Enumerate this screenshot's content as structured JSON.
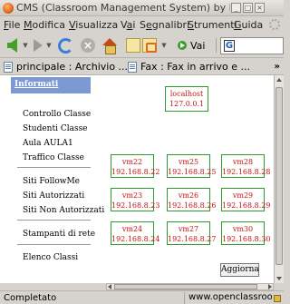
{
  "window": {
    "title": "CMS (Classroom Management System) by Leader.IT S.",
    "buttons": {
      "minimize": "_",
      "maximize": "□",
      "close": "×"
    }
  },
  "menu": {
    "items": [
      {
        "label": "File",
        "underline": "F",
        "rest": "ile"
      },
      {
        "label": "Modifica",
        "underline": "M",
        "rest": "odifica"
      },
      {
        "label": "Visualizza",
        "underline": "V",
        "rest": "isualizza"
      },
      {
        "label": "Vai",
        "pre": "V",
        "underline": "a",
        "rest": "i"
      },
      {
        "label": "Segnalibri",
        "pre": "S",
        "underline": "e",
        "rest": "gnalibri"
      },
      {
        "label": "Strumenti",
        "underline": "S",
        "rest": "trumenti"
      },
      {
        "label": "Guida",
        "underline": "G",
        "rest": "uida"
      }
    ]
  },
  "navigation": {
    "go_label": "Vai",
    "search_value": ""
  },
  "bookmarks": [
    {
      "label": "principale : Archivio ..."
    },
    {
      "label": "Fax : Fax in arrivo e ..."
    }
  ],
  "bookmarks_overflow": "»",
  "sidebar": {
    "heading": "Informati",
    "links": [
      "Controllo Classe",
      "Studenti Classe",
      "Aula AULA1",
      "Traffico Classe",
      "Siti FollowMe",
      "Siti Autorizzati",
      "Siti Non Autorizzati",
      "Stampanti di rete",
      "Elenco Classi"
    ]
  },
  "server": {
    "name": "localhost",
    "ip": "127.0.0.1"
  },
  "machines": [
    {
      "name": "vm22",
      "ip": "192.168.8.22"
    },
    {
      "name": "vm25",
      "ip": "192.168.8.25"
    },
    {
      "name": "vm28",
      "ip": "192.168.8.28"
    },
    {
      "name": "vm23",
      "ip": "192.168.8.23"
    },
    {
      "name": "vm26",
      "ip": "192.168.8.26"
    },
    {
      "name": "vm29",
      "ip": "192.168.8.29"
    },
    {
      "name": "vm24",
      "ip": "192.168.8.24"
    },
    {
      "name": "vm27",
      "ip": "192.168.8.27"
    },
    {
      "name": "vm30",
      "ip": "192.168.8.30"
    }
  ],
  "refresh_label": "Aggiorna",
  "status": {
    "text": "Completato",
    "url": "www.openclassroom.it"
  },
  "colors": {
    "sidebar_heading_bg": "#7d99d4",
    "machine_border": "#2e9a2e",
    "machine_text": "#c31515"
  }
}
